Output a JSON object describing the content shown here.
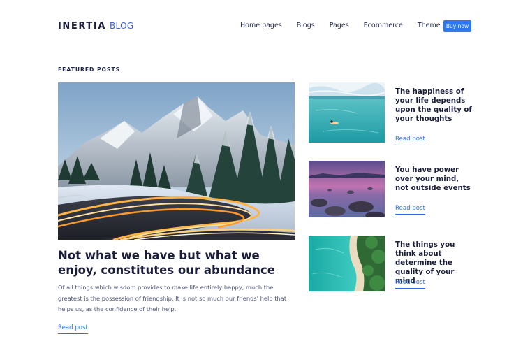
{
  "header": {
    "logo_main": "INERTIA",
    "logo_sub": "BLOG",
    "nav": [
      "Home pages",
      "Blogs",
      "Pages",
      "Ecommerce",
      "Theme docs"
    ],
    "buy_label": "Buy now"
  },
  "featured": {
    "section_label": "FEATURED POSTS",
    "main": {
      "title": "Not what we have but what we enjoy, constitutes our abundance",
      "excerpt": "Of all things which wisdom provides to make life entirely happy, much the greatest is the possession of friendship. It is not so much our friends' help that helps us, as the confidence of their help.",
      "read_label": "Read post"
    },
    "posts": [
      {
        "title": "The happiness of your life depends upon the quality of your thoughts",
        "read_label": "Read post"
      },
      {
        "title": "You have power over your mind, not outside events",
        "read_label": "Read post"
      },
      {
        "title": "The things you think about determine the quality of your mind",
        "read_label": "Read post"
      }
    ]
  },
  "colors": {
    "accent": "#2b78f0",
    "link": "#2b6ee0",
    "heading": "#1a1d3a",
    "body_text": "#4c5274"
  }
}
